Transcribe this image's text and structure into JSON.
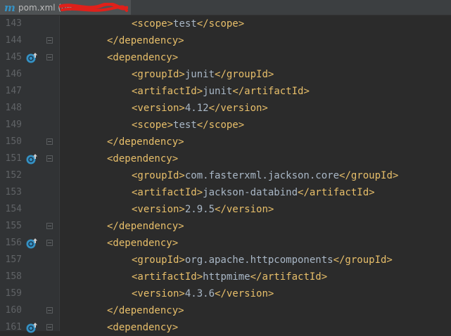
{
  "tab": {
    "icon": "maven-m-icon",
    "filename": "pom.xml",
    "project_hint": "(de"
  },
  "colors": {
    "background": "#2b2b2b",
    "tag": "#e8bf6a",
    "text": "#a9b7c6",
    "line_number": "#606366",
    "marker": "#3592c4"
  },
  "lines": [
    {
      "n": "143",
      "indent": 2,
      "open": "<scope>",
      "text": "test",
      "close": "</scope>",
      "marker": false
    },
    {
      "n": "144",
      "indent": 1,
      "open": "",
      "text": "",
      "close": "</dependency>",
      "marker": false
    },
    {
      "n": "145",
      "indent": 1,
      "open": "<dependency>",
      "text": "",
      "close": "",
      "marker": true
    },
    {
      "n": "146",
      "indent": 2,
      "open": "<groupId>",
      "text": "junit",
      "close": "</groupId>",
      "marker": false
    },
    {
      "n": "147",
      "indent": 2,
      "open": "<artifactId>",
      "text": "junit",
      "close": "</artifactId>",
      "marker": false
    },
    {
      "n": "148",
      "indent": 2,
      "open": "<version>",
      "text": "4.12",
      "close": "</version>",
      "marker": false
    },
    {
      "n": "149",
      "indent": 2,
      "open": "<scope>",
      "text": "test",
      "close": "</scope>",
      "marker": false
    },
    {
      "n": "150",
      "indent": 1,
      "open": "",
      "text": "",
      "close": "</dependency>",
      "marker": false
    },
    {
      "n": "151",
      "indent": 1,
      "open": "<dependency>",
      "text": "",
      "close": "",
      "marker": true
    },
    {
      "n": "152",
      "indent": 2,
      "open": "<groupId>",
      "text": "com.fasterxml.jackson.core",
      "close": "</groupId>",
      "marker": false
    },
    {
      "n": "153",
      "indent": 2,
      "open": "<artifactId>",
      "text": "jackson-databind",
      "close": "</artifactId>",
      "marker": false
    },
    {
      "n": "154",
      "indent": 2,
      "open": "<version>",
      "text": "2.9.5",
      "close": "</version>",
      "marker": false
    },
    {
      "n": "155",
      "indent": 1,
      "open": "",
      "text": "",
      "close": "</dependency>",
      "marker": false
    },
    {
      "n": "156",
      "indent": 1,
      "open": "<dependency>",
      "text": "",
      "close": "",
      "marker": true
    },
    {
      "n": "157",
      "indent": 2,
      "open": "<groupId>",
      "text": "org.apache.httpcomponents",
      "close": "</groupId>",
      "marker": false
    },
    {
      "n": "158",
      "indent": 2,
      "open": "<artifactId>",
      "text": "httpmime",
      "close": "</artifactId>",
      "marker": false
    },
    {
      "n": "159",
      "indent": 2,
      "open": "<version>",
      "text": "4.3.6",
      "close": "</version>",
      "marker": false
    },
    {
      "n": "160",
      "indent": 1,
      "open": "",
      "text": "",
      "close": "</dependency>",
      "marker": false
    },
    {
      "n": "161",
      "indent": 1,
      "open": "<dependency>",
      "text": "",
      "close": "",
      "marker": true
    }
  ]
}
